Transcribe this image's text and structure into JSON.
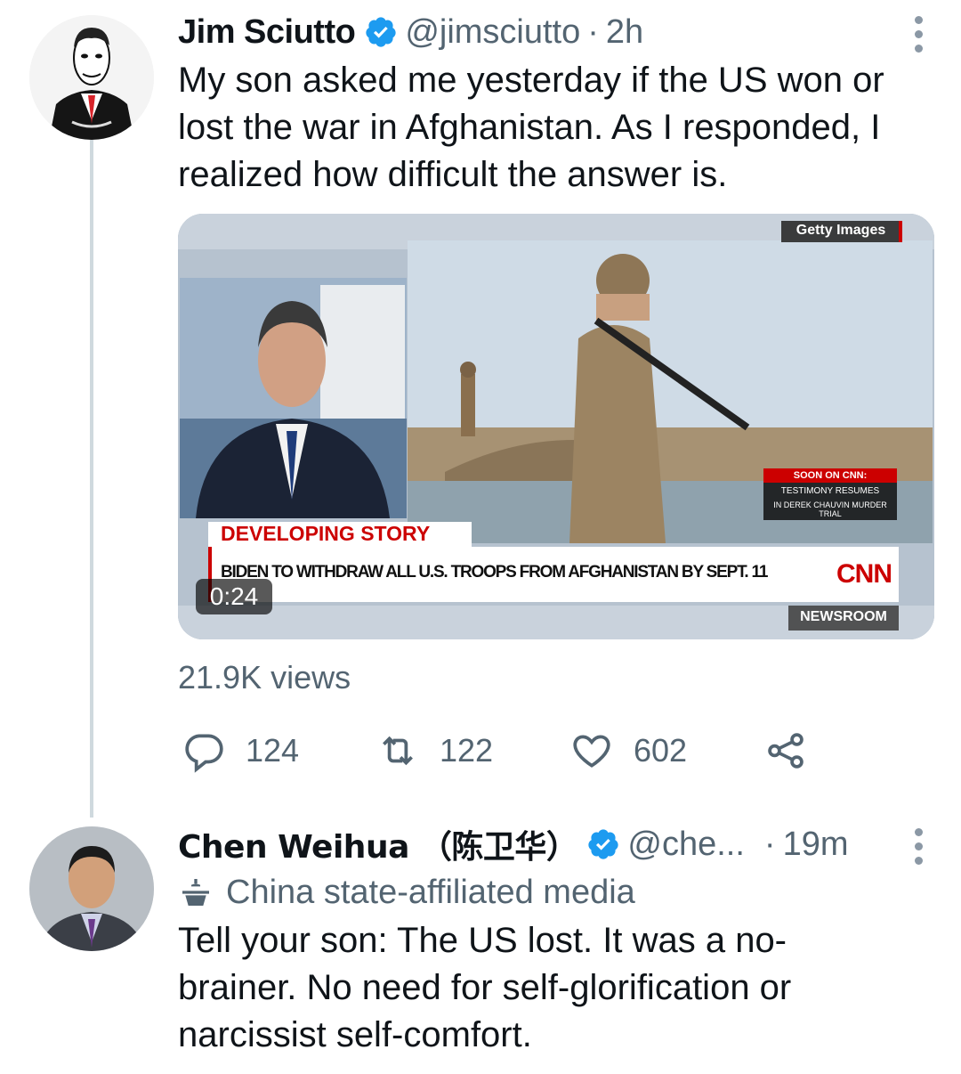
{
  "tweet1": {
    "name": "Jim Sciutto",
    "handle": "@jimsciutto",
    "separator": "·",
    "time": "2h",
    "text": "My son asked me yesterday if the US won or lost the war in Afghanistan. As I responded, I realized how difficult the answer is.",
    "views": "21.9K views",
    "replies": "124",
    "retweets": "122",
    "likes": "602",
    "video": {
      "credit": "Getty Images",
      "banner_top": "DEVELOPING STORY",
      "banner_main": "BIDEN TO WITHDRAW ALL U.S. TROOPS FROM AFGHANISTAN BY SEPT. 11",
      "soon_label": "SOON ON CNN:",
      "soon_line1": "TESTIMONY RESUMES",
      "soon_line2": "IN DEREK CHAUVIN MURDER TRIAL",
      "network_logo": "CNN",
      "program": "NEWSROOM",
      "duration": "0:24"
    }
  },
  "tweet2": {
    "name": "Chen Weihua （陈卫华）",
    "handle": "@che...",
    "separator": "·",
    "time": "19m",
    "affiliation": "China state-affiliated media",
    "text": "Tell your son: The US lost.  It was a no-brainer.  No need for self-glorification or narcissist self-comfort."
  },
  "colors": {
    "verified": "#1d9bf0",
    "secondary_text": "#536471",
    "cnn_red": "#cc0000"
  }
}
